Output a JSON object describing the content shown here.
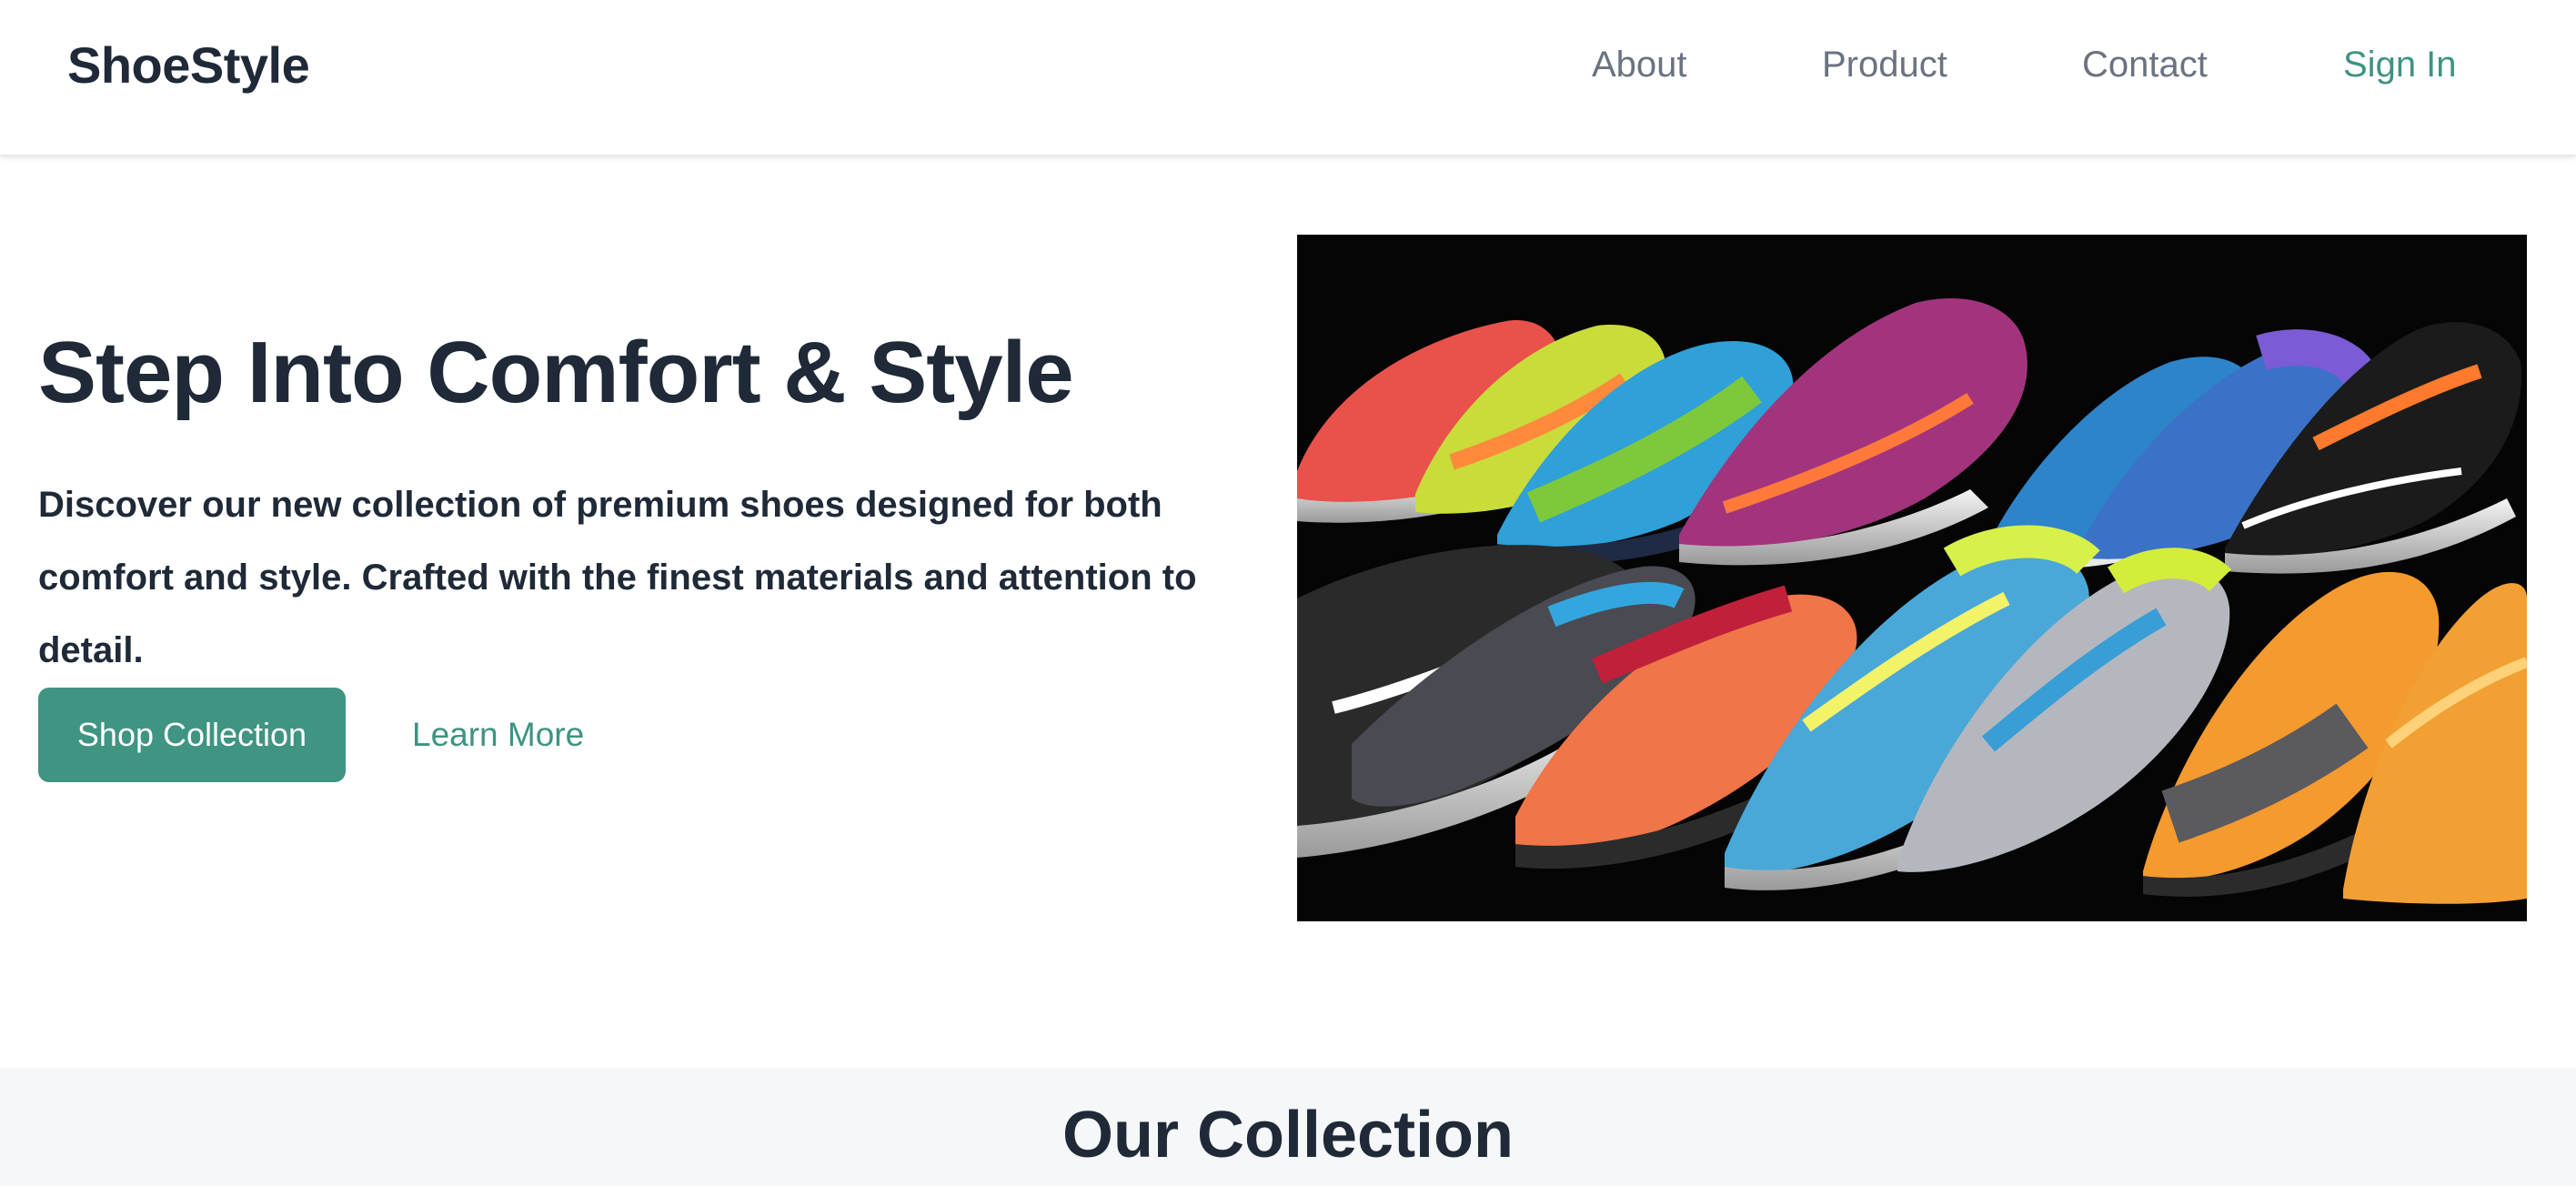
{
  "brand": {
    "name": "ShoeStyle",
    "accent_color": "#3f9482"
  },
  "nav": {
    "about": "About",
    "product": "Product",
    "contact": "Contact",
    "sign_in": "Sign In"
  },
  "hero": {
    "title": "Step Into Comfort & Style",
    "description": "Discover our new collection of premium shoes designed for both comfort and style. Crafted with the finest materials and attention to detail.",
    "primary_button": "Shop Collection",
    "secondary_link": "Learn More",
    "image": "colorful-running-shoes-photo"
  },
  "collection": {
    "title": "Our Collection"
  }
}
